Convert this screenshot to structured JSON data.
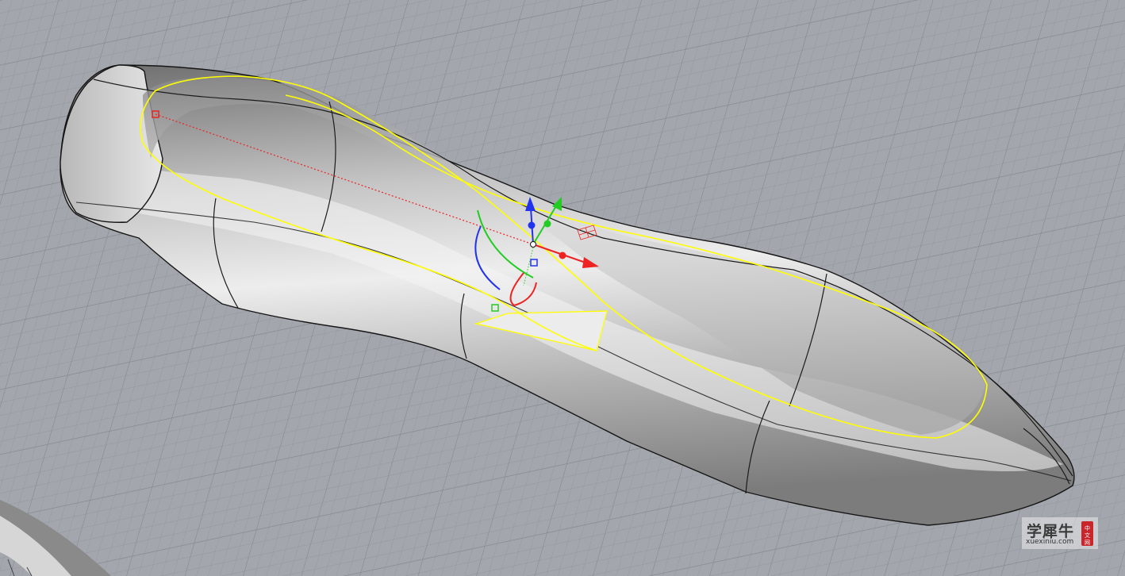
{
  "viewport": {
    "background_color": "#a3a7ad",
    "grid_color": "#8e939a",
    "model": "revolved bottle-shaped surface with yellow trimming curve",
    "selection_color": "#ffff00",
    "curve_color": "#1a1a1a"
  },
  "gizmo": {
    "x_axis_color": "#ee2222",
    "y_axis_color": "#22cc22",
    "z_axis_color": "#2233ee"
  },
  "watermark": {
    "title": "学犀牛",
    "url": "xuexiniu.com",
    "seal": "中文网",
    "seal_color": "#c8262b"
  }
}
